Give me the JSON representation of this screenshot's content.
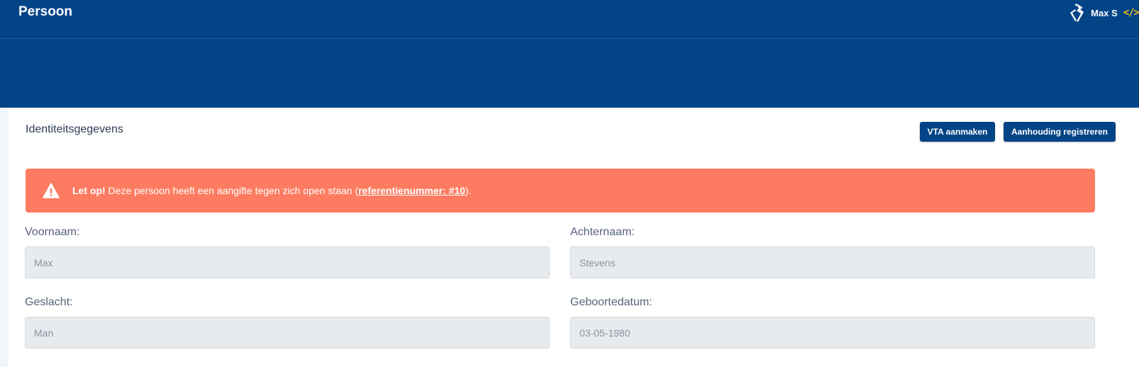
{
  "header": {
    "title": "Persoon",
    "user_name": "Max S",
    "code_icon_glyph": "</>",
    "logo_icon": "police-logo-icon"
  },
  "card": {
    "title": "Identiteitsgegevens",
    "buttons": {
      "vta": "VTA aanmaken",
      "arrest": "Aanhouding registreren"
    }
  },
  "alert": {
    "icon": "warning-icon",
    "strong": "Let op!",
    "message": " Deze persoon heeft een aangifte tegen zich open staan (",
    "link": "referentienummer: #10",
    "suffix": ")."
  },
  "fields": {
    "voornaam": {
      "label": "Voornaam:",
      "value": "Max"
    },
    "achternaam": {
      "label": "Achternaam:",
      "value": "Stevens"
    },
    "geslacht": {
      "label": "Geslacht:",
      "value": "Man"
    },
    "geboortedatum": {
      "label": "Geboortedatum:",
      "value": "03-05-1980"
    }
  },
  "colors": {
    "header_bg": "#034486",
    "alert_bg": "#fd7c61",
    "button_bg": "#034486",
    "accent_code": "#f5c518"
  }
}
